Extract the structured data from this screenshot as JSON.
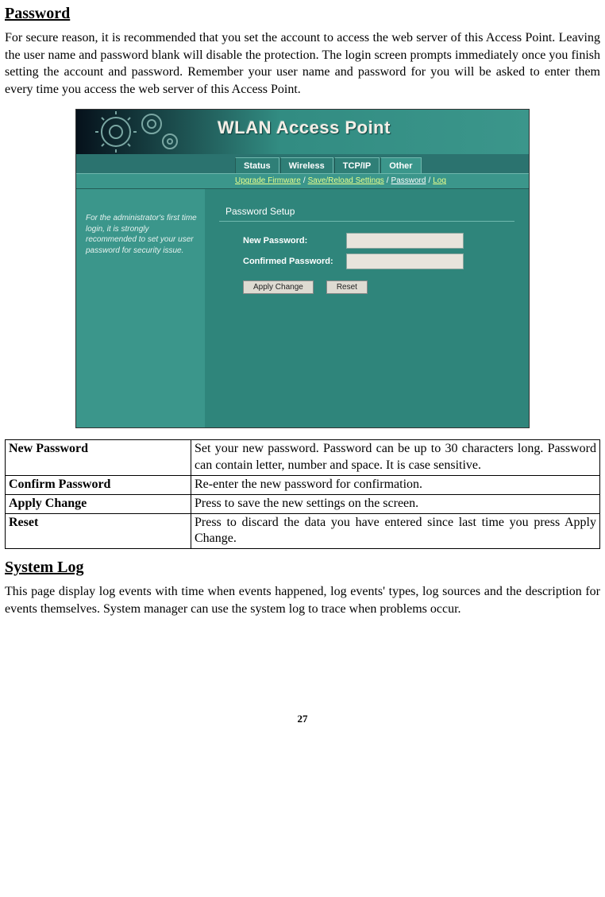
{
  "headings": {
    "password": "Password",
    "system_log": "System Log"
  },
  "paragraphs": {
    "password_intro": "For secure reason, it is recommended that you set the account to access the web server of this Access Point. Leaving the user name and password blank will disable the protection. The login screen prompts immediately once you finish setting the account and password. Remember your user name and password for you will be asked to enter them every time you access the web server of this Access Point.",
    "system_log_intro": "This page display log events with time when events happened, log events' types, log sources and the description for events themselves. System manager can use the system log to trace when problems occur."
  },
  "router_ui": {
    "title": "WLAN Access Point",
    "tabs": {
      "status": "Status",
      "wireless": "Wireless",
      "tcpip": "TCP/IP",
      "other": "Other"
    },
    "subtabs": {
      "upgrade": "Upgrade Firmware",
      "save_reload": "Save/Reload Settings",
      "password": "Password",
      "log": "Log"
    },
    "side_hint": "For the administrator's first time login, it is strongly recommended to set your user password for security issue.",
    "panel_title": "Password Setup",
    "labels": {
      "new_password": "New Password:",
      "confirmed_password": "Confirmed Password:"
    },
    "buttons": {
      "apply": "Apply Change",
      "reset": "Reset"
    }
  },
  "definitions": [
    {
      "key": "New Password",
      "val": "Set your new password. Password can be up to 30 characters long. Password can contain letter, number and space. It is case sensitive."
    },
    {
      "key": "Confirm Password",
      "val": "Re-enter the new password for confirmation."
    },
    {
      "key": "Apply Change",
      "val": "Press to save the new settings on the screen."
    },
    {
      "key": "Reset",
      "val": "Press to discard the data you have entered since last time you press Apply Change."
    }
  ],
  "page_number": "27"
}
